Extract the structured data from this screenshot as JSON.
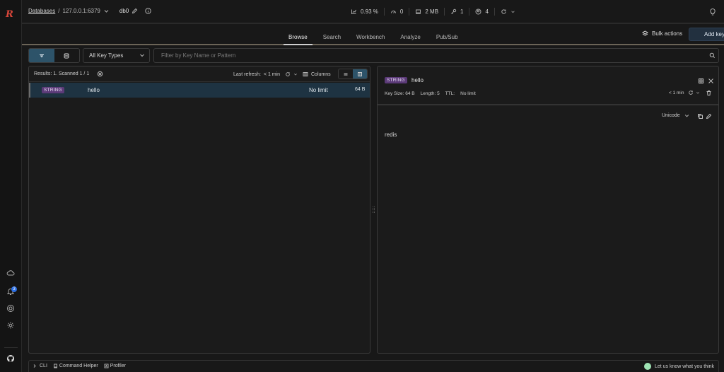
{
  "brand": {
    "logo": "R",
    "logo_color": "#d9463a"
  },
  "sidebar": {
    "icons": [
      "cloud-icon",
      "bell-icon",
      "help-icon",
      "settings-icon",
      "github-icon"
    ],
    "notification_count": "3"
  },
  "header": {
    "databases_link": "Databases",
    "separator": "/",
    "host": "127.0.0.1:6379",
    "db": "db0",
    "stats": [
      {
        "icon": "cpu-icon",
        "value": "0.93 %"
      },
      {
        "icon": "ops-icon",
        "value": "0"
      },
      {
        "icon": "memory-icon",
        "value": "2 MB"
      },
      {
        "icon": "keys-icon",
        "value": "1"
      },
      {
        "icon": "clients-icon",
        "value": "4"
      }
    ]
  },
  "nav": {
    "tabs": [
      {
        "label": "Browse",
        "active": true
      },
      {
        "label": "Search",
        "active": false
      },
      {
        "label": "Workbench",
        "active": false
      },
      {
        "label": "Analyze",
        "active": false
      },
      {
        "label": "Pub/Sub",
        "active": false
      }
    ],
    "bulk_actions": "Bulk actions",
    "add_key": "Add key"
  },
  "filter": {
    "key_type": "All Key Types",
    "search_placeholder": "Filter by Key Name or Pattern",
    "search_value": ""
  },
  "list": {
    "results": "Results: 1. Scanned 1 / 1",
    "last_refresh_label": "Last refresh:",
    "last_refresh_value": "< 1 min",
    "columns_label": "Columns",
    "rows": [
      {
        "type": "STRING",
        "name": "hello",
        "ttl": "No limit",
        "size": "64 B"
      }
    ]
  },
  "detail": {
    "type": "STRING",
    "key_name": "hello",
    "key_size": "Key Size: 64 B",
    "length": "Length: 5",
    "ttl_label": "TTL:",
    "ttl_value": "No limit",
    "refresh_value": "< 1 min",
    "format": "Unicode",
    "value": "redis"
  },
  "bottom": {
    "cli": "CLI",
    "command_helper": "Command Helper",
    "profiler": "Profiler",
    "feedback": "Let us know what you think"
  },
  "colors": {
    "accent": "#2d5369",
    "string_badge": "#5b3a78",
    "selected_row": "#1e3342"
  }
}
